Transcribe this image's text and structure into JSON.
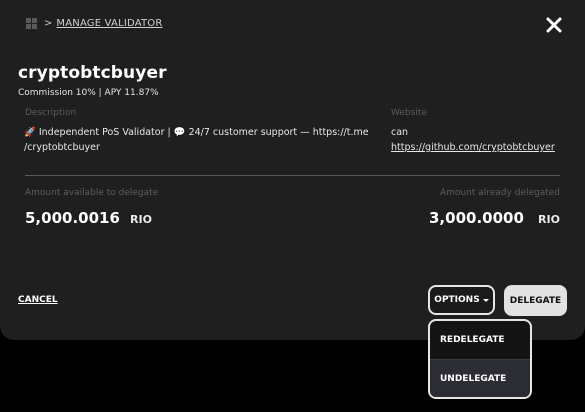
{
  "breadcrumb": {
    "separator": ">",
    "label": "MANAGE VALIDATOR"
  },
  "validator": {
    "name": "cryptobtcbuyer",
    "commission_line": "Commission 10% | APY 11.87%"
  },
  "description": {
    "label": "Description",
    "text": "🚀 Independent PoS Validator | 💬 24/7 customer support — https://t.me /cryptobtcbuyer"
  },
  "website": {
    "label": "Website",
    "line1": "can",
    "link": "https://github.com/cryptobtcbuyer"
  },
  "amounts": {
    "available_label": "Amount available to delegate",
    "available_value": "5,000.0016",
    "available_unit": "RIO",
    "delegated_label": "Amount already delegated",
    "delegated_value": "3,000.0000",
    "delegated_unit": "RIO"
  },
  "actions": {
    "cancel": "CANCEL",
    "options": "OPTIONS",
    "delegate": "DELEGATE"
  },
  "dropdown": {
    "items": [
      {
        "label": "REDELEGATE"
      },
      {
        "label": "UNDELEGATE"
      }
    ]
  },
  "icons": {
    "breadcrumb": "grid-icon",
    "close": "close-icon",
    "options_caret": "caret-down-icon"
  },
  "colors": {
    "modal_bg": "#1f1f1f",
    "page_bg": "#000000",
    "delegate_button_bg": "#e2e2e2",
    "dropdown_highlight": "#2c2c35",
    "muted_label": "#5d5d5d"
  }
}
